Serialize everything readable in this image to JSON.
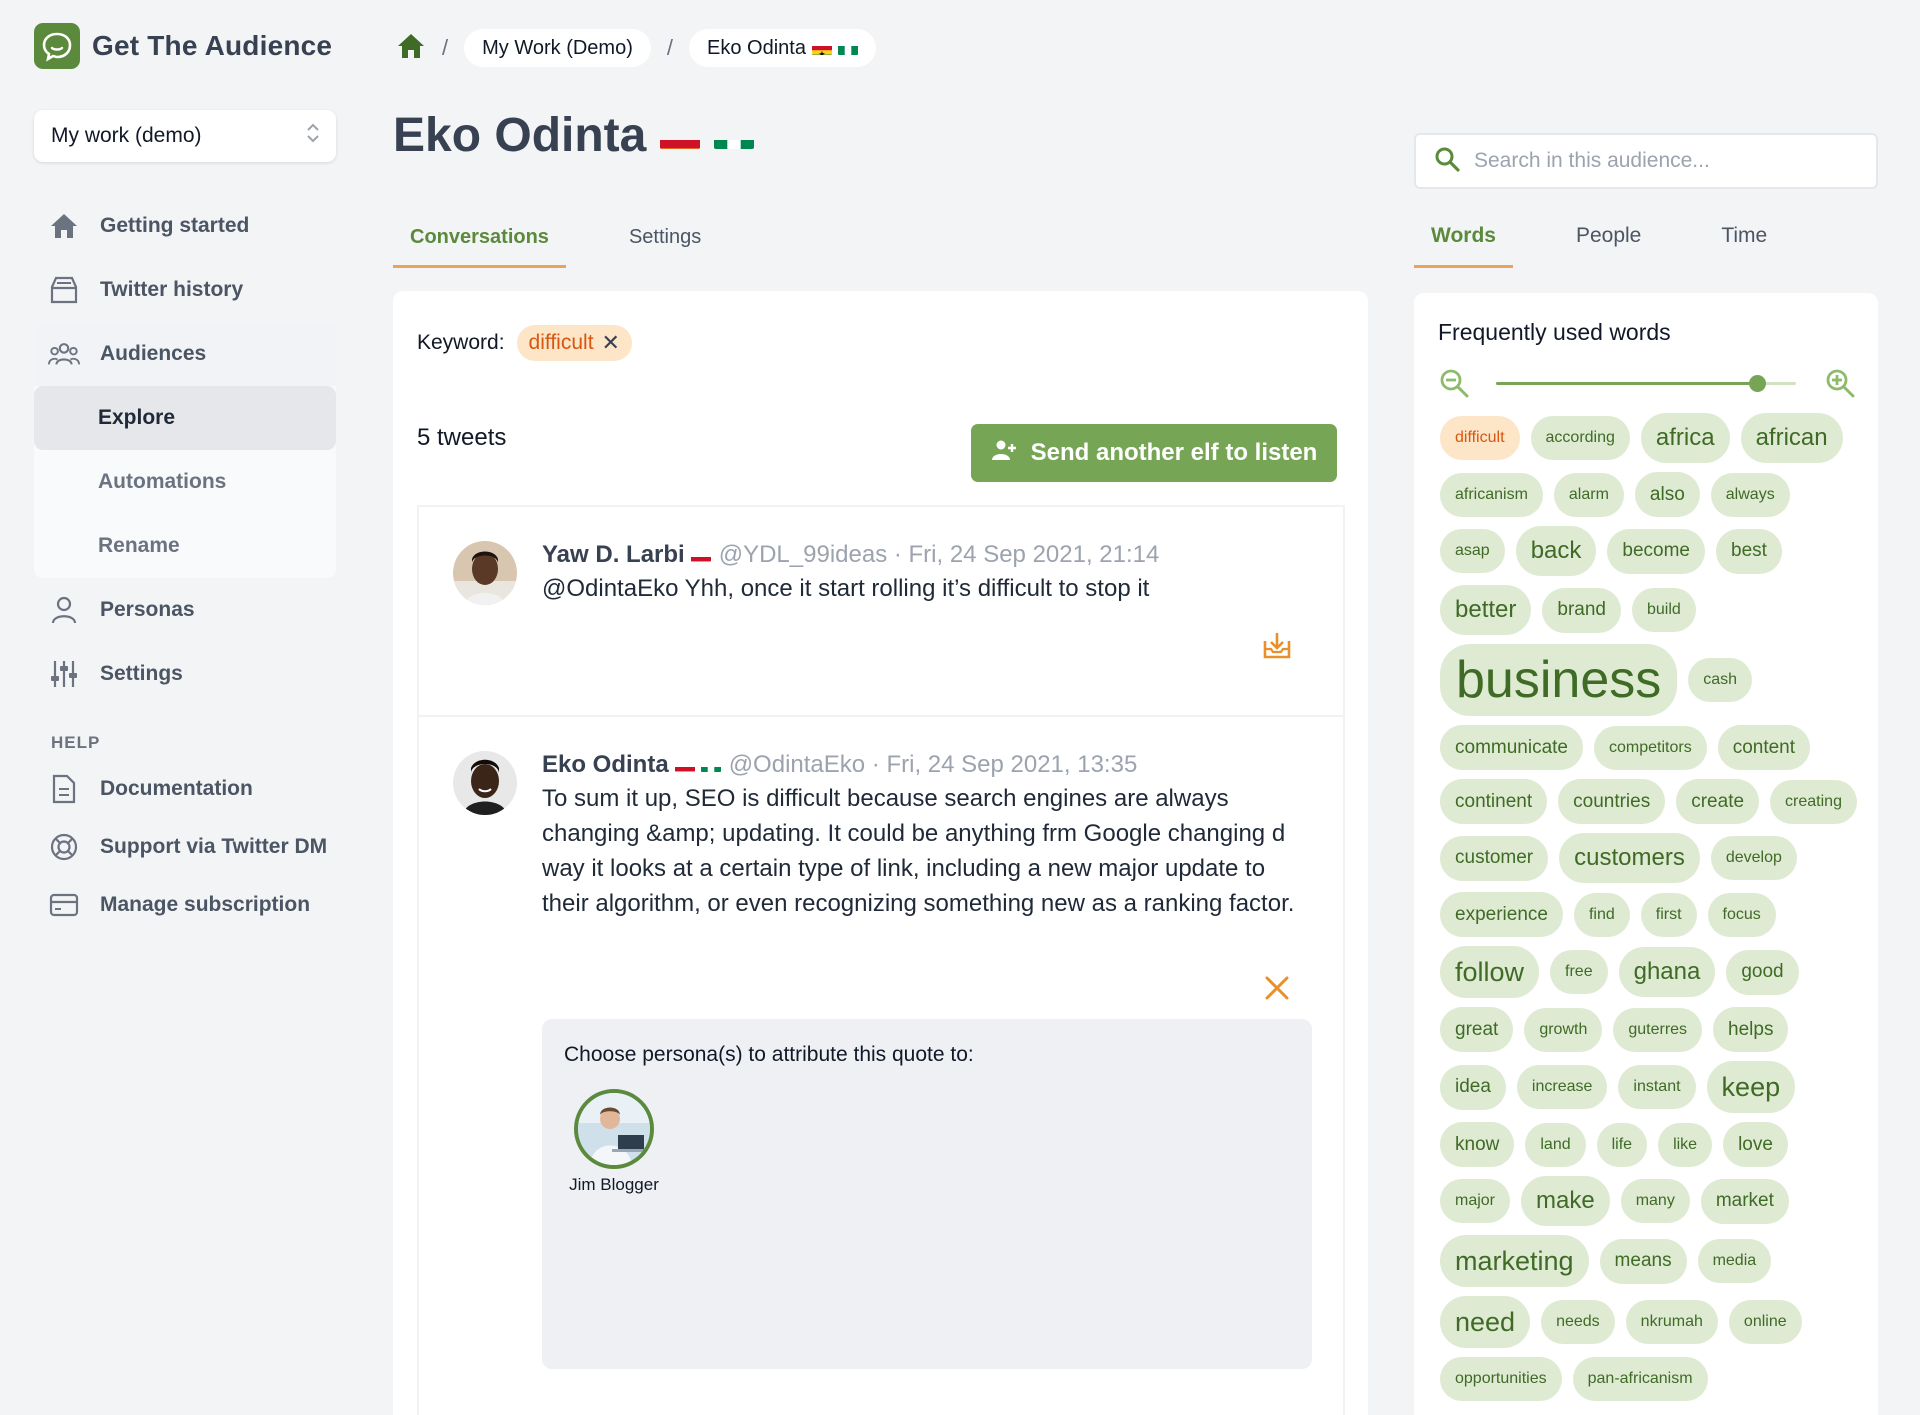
{
  "app": {
    "name": "Get The Audience"
  },
  "workspace": {
    "selected": "My work (demo)"
  },
  "nav": {
    "getting_started": "Getting started",
    "twitter_history": "Twitter history",
    "audiences": "Audiences",
    "explore": "Explore",
    "automations": "Automations",
    "rename": "Rename",
    "personas": "Personas",
    "settings": "Settings",
    "help_heading": "HELP",
    "documentation": "Documentation",
    "support": "Support via Twitter DM",
    "manage_subscription": "Manage subscription"
  },
  "breadcrumb": {
    "workspace": "My Work (Demo)",
    "audience": "Eko Odinta",
    "separator": "/"
  },
  "page": {
    "title": "Eko Odinta"
  },
  "tabs": {
    "conversations": "Conversations",
    "settings": "Settings"
  },
  "filter": {
    "keyword_label": "Keyword:",
    "keyword": "difficult"
  },
  "summary": {
    "tweet_count": "5 tweets",
    "elf_button": "Send another elf to listen"
  },
  "tweets": [
    {
      "name": "Yaw D. Larbi",
      "handle": "@YDL_99ideas",
      "separator": " · ",
      "time": "Fri, 24 Sep 2021, 21:14",
      "text": "@OdintaEko Yhh, once it start rolling it’s difficult to stop it"
    },
    {
      "name": "Eko Odinta",
      "handle": "@OdintaEko",
      "separator": " · ",
      "time": "Fri, 24 Sep 2021, 13:35",
      "text": "To sum it up, SEO is difficult because search engines are always changing &amp; updating. It could be anything frm Google changing d way it looks at a certain type of link, including a new major update to their algorithm, or even recognizing something new as a ranking factor."
    }
  ],
  "persona_picker": {
    "title": "Choose persona(s) to attribute this quote to:",
    "persona_name": "Jim Blogger"
  },
  "search": {
    "placeholder": "Search in this audience..."
  },
  "right_tabs": {
    "words": "Words",
    "people": "People",
    "time": "Time"
  },
  "words_panel": {
    "title": "Frequently used words",
    "zoom_level": 0.87,
    "words": [
      "difficult",
      "according",
      "africa",
      "african",
      "africanism",
      "alarm",
      "also",
      "always",
      "asap",
      "back",
      "become",
      "best",
      "better",
      "brand",
      "build",
      "business",
      "cash",
      "communicate",
      "competitors",
      "content",
      "continent",
      "countries",
      "create",
      "creating",
      "customer",
      "customers",
      "develop",
      "experience",
      "find",
      "first",
      "focus",
      "follow",
      "free",
      "ghana",
      "good",
      "great",
      "growth",
      "guterres",
      "helps",
      "idea",
      "increase",
      "instant",
      "keep",
      "know",
      "land",
      "life",
      "like",
      "love",
      "major",
      "make",
      "many",
      "market",
      "marketing",
      "means",
      "media",
      "need",
      "needs",
      "nkrumah",
      "online",
      "opportunities",
      "pan-africanism"
    ]
  },
  "colors": {
    "accent": "#5b8a3c",
    "button": "#76a655",
    "highlight": "#d9560f",
    "chip": "#dfead3"
  }
}
